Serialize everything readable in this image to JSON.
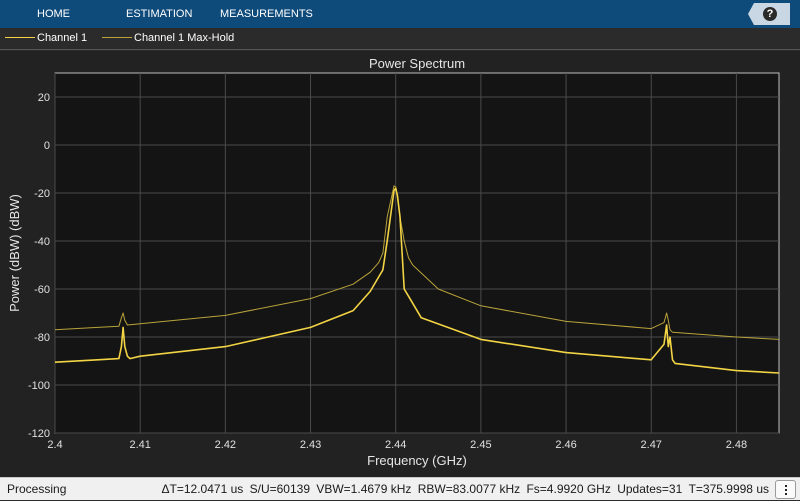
{
  "toolstrip": {
    "tabs": [
      "HOME",
      "ESTIMATION",
      "MEASUREMENTS"
    ],
    "help_label": "?",
    "background": "#0e4a7a"
  },
  "legend": [
    {
      "name": "Channel 1",
      "color": "#f2d444"
    },
    {
      "name": "Channel 1 Max-Hold",
      "color": "#b9a33a"
    }
  ],
  "chart_data": {
    "type": "line",
    "title": "Power Spectrum",
    "xlabel": "Frequency (GHz)",
    "ylabel": "Power (dBW) (dBW)",
    "xlim": [
      2.4,
      2.485
    ],
    "ylim": [
      -120,
      30
    ],
    "xticks": [
      2.4,
      2.41,
      2.42,
      2.43,
      2.44,
      2.45,
      2.46,
      2.47,
      2.48
    ],
    "xtick_labels": [
      "2.4",
      "2.41",
      "2.42",
      "2.43",
      "2.44",
      "2.45",
      "2.46",
      "2.47",
      "2.48"
    ],
    "yticks": [
      20,
      0,
      -20,
      -40,
      -60,
      -80,
      -100,
      -120
    ],
    "ytick_labels": [
      "20",
      "0",
      "-20",
      "-40",
      "-60",
      "-80",
      "-100",
      "-120"
    ],
    "grid": true,
    "series": [
      {
        "name": "Channel 1",
        "color": "#f2d444",
        "x": [
          2.4,
          2.405,
          2.4075,
          2.4078,
          2.408,
          2.4082,
          2.4085,
          2.4088,
          2.41,
          2.42,
          2.43,
          2.435,
          2.437,
          2.4385,
          2.439,
          2.4395,
          2.4398,
          2.44,
          2.4402,
          2.4405,
          2.441,
          2.4415,
          2.443,
          2.45,
          2.46,
          2.47,
          2.4715,
          2.4718,
          2.472,
          2.4722,
          2.4725,
          2.4728,
          2.48,
          2.485
        ],
        "y": [
          -90.5,
          -89.5,
          -89,
          -84,
          -76,
          -84,
          -88,
          -89,
          -88,
          -84,
          -76,
          -69,
          -61,
          -52,
          -40,
          -27,
          -19,
          -18,
          -21,
          -30,
          -60,
          -63,
          -72,
          -81,
          -86.5,
          -89.5,
          -83,
          -75,
          -84,
          -80,
          -89.5,
          -91,
          -94,
          -95
        ]
      },
      {
        "name": "Channel 1 Max-Hold",
        "color": "#b9a33a",
        "x": [
          2.4,
          2.405,
          2.4075,
          2.4078,
          2.408,
          2.4082,
          2.4085,
          2.41,
          2.42,
          2.43,
          2.435,
          2.437,
          2.438,
          2.4385,
          2.439,
          2.4395,
          2.4398,
          2.44,
          2.4402,
          2.4405,
          2.441,
          2.4415,
          2.442,
          2.445,
          2.45,
          2.46,
          2.47,
          2.4715,
          2.4718,
          2.472,
          2.4722,
          2.4725,
          2.48,
          2.485
        ],
        "y": [
          -77,
          -76,
          -75.5,
          -72,
          -70,
          -73,
          -75,
          -74.5,
          -71,
          -64,
          -58,
          -53,
          -49,
          -45,
          -30,
          -22,
          -17,
          -17.5,
          -22,
          -30,
          -40,
          -47,
          -50,
          -60,
          -67,
          -73.5,
          -76.5,
          -74,
          -70,
          -73,
          -77,
          -78,
          -80,
          -81
        ]
      }
    ]
  },
  "status": {
    "left": "Processing",
    "items": [
      "ΔT=12.0471 us",
      "S/U=60139",
      "VBW=1.4679 kHz",
      "RBW=83.0077 kHz",
      "Fs=4.9920 GHz",
      "Updates=31",
      "T=375.9998 us"
    ]
  }
}
